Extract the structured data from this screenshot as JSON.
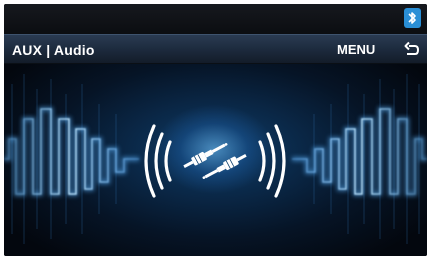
{
  "header": {
    "title": "AUX | Audio",
    "menu_label": "MENU"
  },
  "icons": {
    "status": "bluetooth-icon",
    "back": "back-arrow-icon",
    "center": "aux-cable-icon"
  },
  "colors": {
    "background": "#050a10",
    "accent": "#4fb8ff",
    "glow": "#9fdcff",
    "title_bar": "#1d2b3e",
    "text": "#ffffff"
  }
}
